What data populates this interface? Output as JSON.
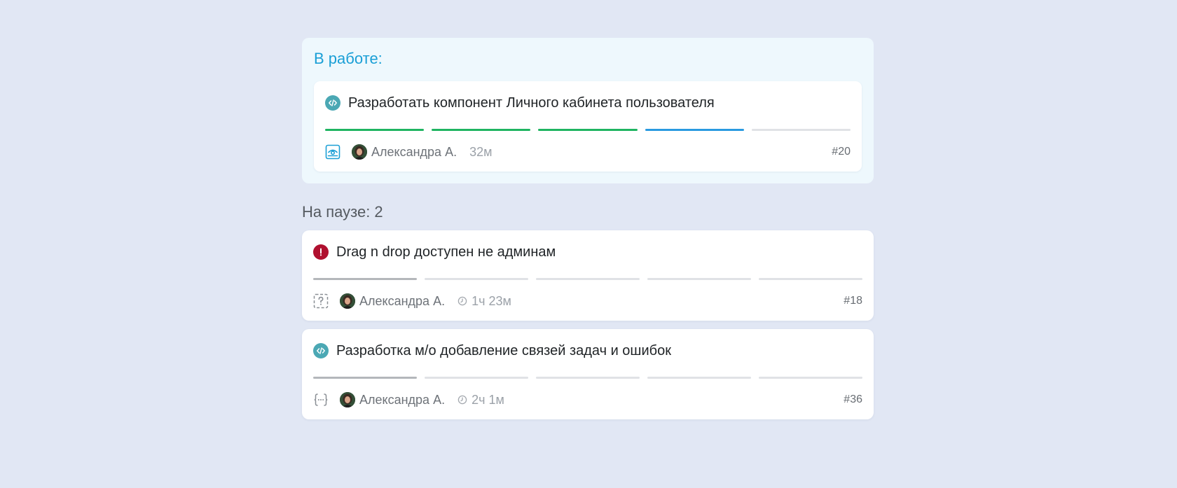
{
  "in_progress": {
    "title": "В работе:",
    "task": {
      "icon": "code-icon",
      "title": "Разработать компонент Личного кабинета пользователя",
      "progress": [
        "done",
        "done",
        "done",
        "current",
        "todo"
      ],
      "status_icon": "review-icon",
      "author": "Александра А.",
      "time": "32м",
      "id": "#20"
    }
  },
  "paused": {
    "title": "На паузе: 2",
    "tasks": [
      {
        "icon": "bug-icon",
        "title": "Drag n drop доступен не админам",
        "progress": [
          "active",
          "todo",
          "todo",
          "todo",
          "todo"
        ],
        "status_icon": "question-icon",
        "author": "Александра А.",
        "time": "1ч 23м",
        "id": "#18"
      },
      {
        "icon": "code-icon",
        "title": "Разработка м/о добавление связей задач и ошибок",
        "progress": [
          "active",
          "todo",
          "todo",
          "todo",
          "todo"
        ],
        "status_icon": "code-braces-icon",
        "author": "Александра А.",
        "time": "2ч 1м",
        "id": "#36"
      }
    ]
  },
  "colors": {
    "done": "#1fb461",
    "current": "#2a9ae0",
    "active": "#b4b7bb",
    "todo": "#e0e2e6",
    "accent": "#1a9fd6"
  }
}
